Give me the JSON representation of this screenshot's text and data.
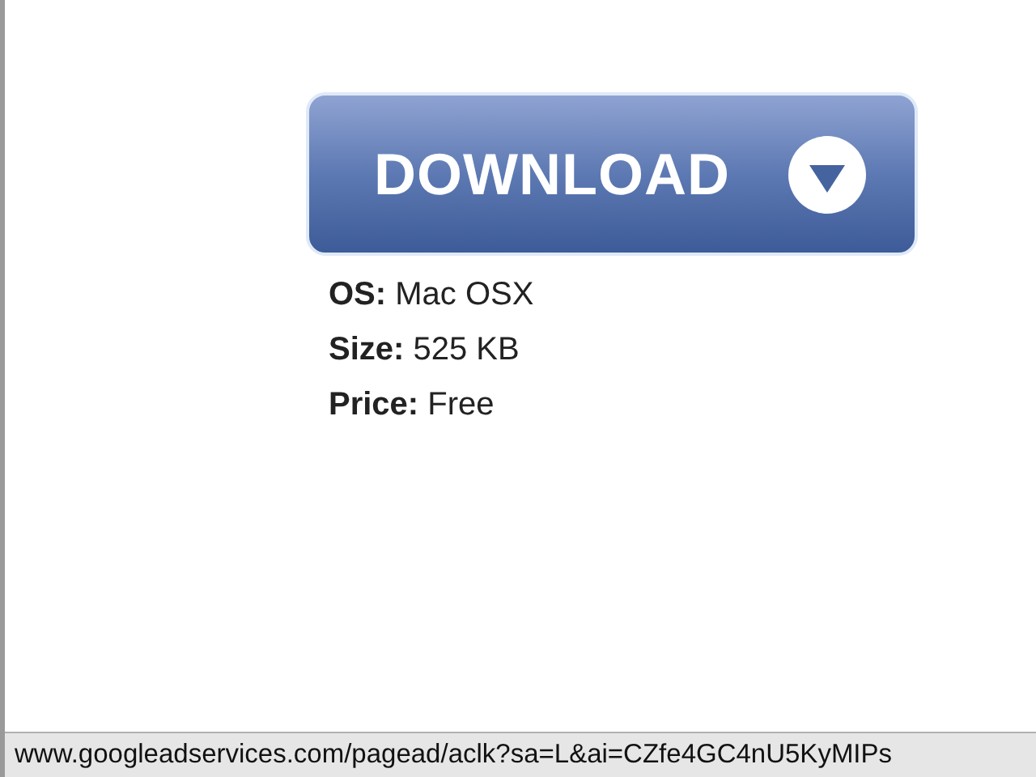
{
  "download_button": {
    "label": "DOWNLOAD"
  },
  "details": [
    {
      "label": "OS:",
      "value": "Mac OSX"
    },
    {
      "label": "Size:",
      "value": "525 KB"
    },
    {
      "label": "Price:",
      "value": "Free"
    }
  ],
  "status_bar": {
    "url": "www.googleadservices.com/pagead/aclk?sa=L&ai=CZfe4GC4nU5KyMIPs"
  }
}
